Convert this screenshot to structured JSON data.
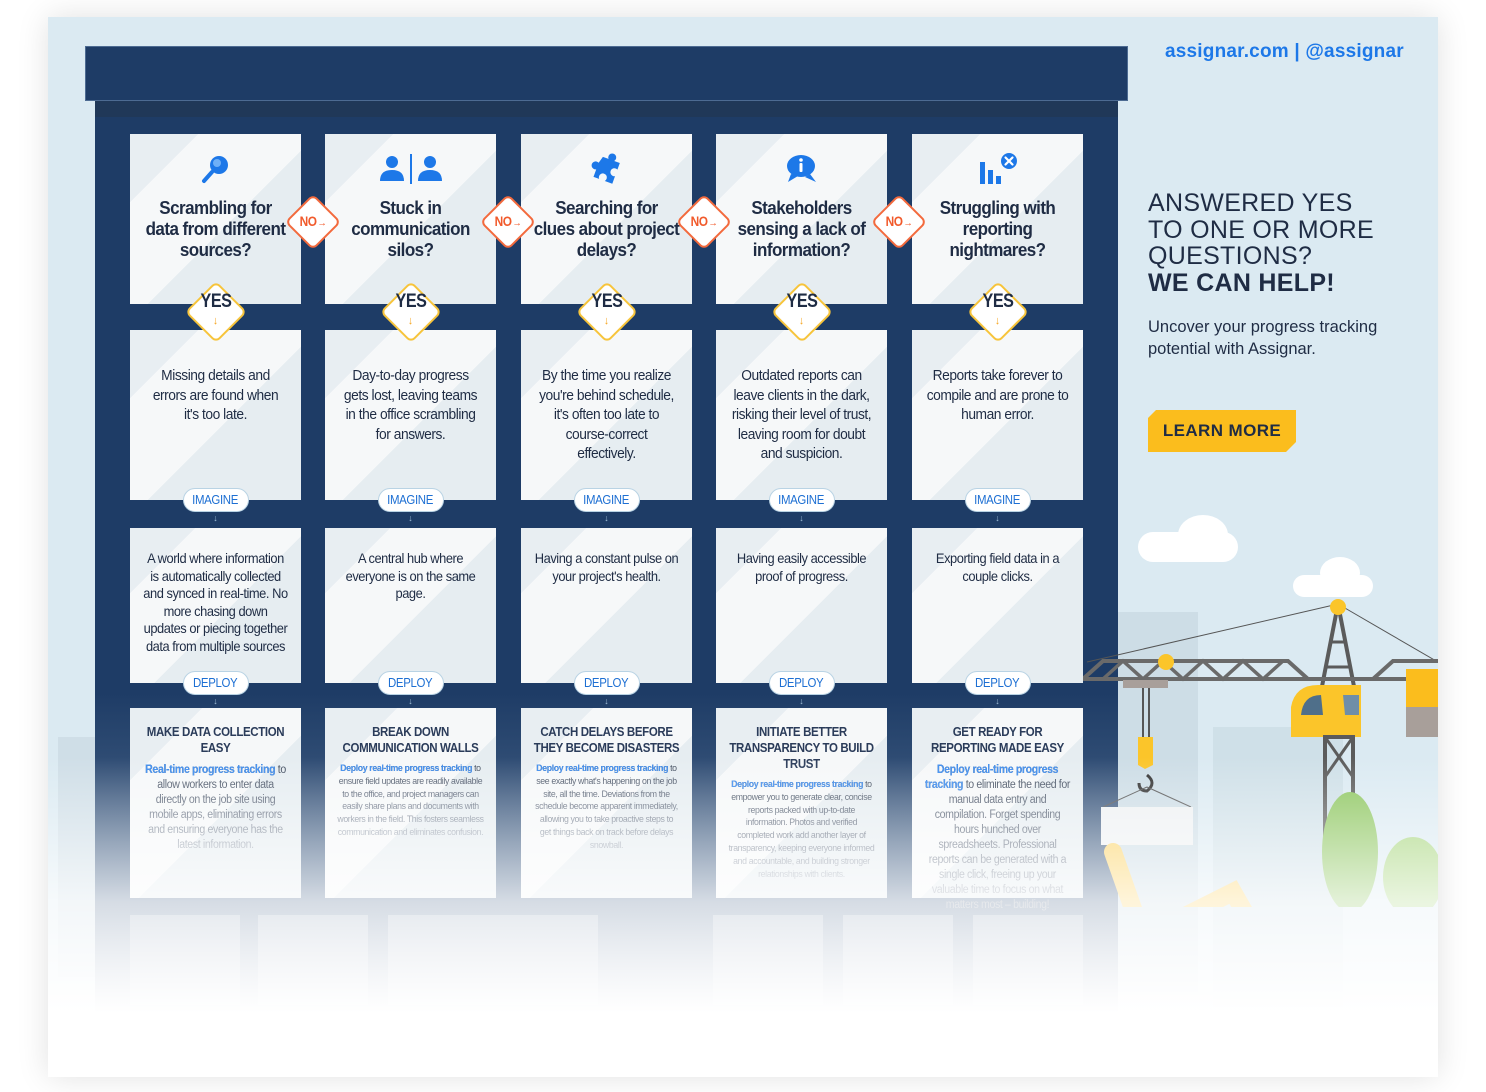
{
  "header": {
    "site_link": "assignar.com | @assignar"
  },
  "cta": {
    "headline_lines": [
      "ANSWERED YES",
      "TO ONE OR MORE",
      "QUESTIONS?"
    ],
    "headline_strong": "WE CAN HELP!",
    "subtext": "Uncover your progress tracking potential with Assignar.",
    "button_label": "LEARN MORE",
    "button_color": "#fbbd1d"
  },
  "labels": {
    "no": "NO",
    "yes": "YES",
    "imagine": "IMAGINE",
    "deploy": "DEPLOY"
  },
  "colors": {
    "building": "#1e3c66",
    "no_badge": "#f15a2b",
    "yes_badge": "#f7c43b",
    "link_blue": "#1d78e8",
    "highlight_blue": "#3f8ef0"
  },
  "columns": [
    {
      "icon": "magnifier-icon",
      "question": "Scrambling for data from different sources?",
      "problem": "Missing details and errors are found when it's too late.",
      "imagine": "A world where information is automatically collected and synced in real-time. No more chasing down updates or piecing together data from multiple sources",
      "solution_title": "MAKE DATA COLLECTION EASY",
      "solution_highlight": "Real-time progress tracking",
      "solution_body": " to allow workers to enter data directly on the job site using mobile apps, eliminating errors and ensuring everyone has the latest information."
    },
    {
      "icon": "users-divided-icon",
      "question": "Stuck in communication silos?",
      "problem": "Day-to-day progress gets lost, leaving teams in the office scrambling for answers.",
      "imagine": "A central hub where everyone is on the same page.",
      "solution_title": "BREAK DOWN COMMUNICATION WALLS",
      "solution_highlight": "Deploy real-time progress tracking",
      "solution_body": " to ensure field updates are readily available to the office, and project managers can easily share plans and documents with workers in the field. This fosters seamless communication and eliminates confusion."
    },
    {
      "icon": "puzzle-piece-icon",
      "question": "Searching for clues about project delays?",
      "problem": "By the time you realize you're behind schedule, it's often too late to course-correct effectively.",
      "imagine": "Having a constant pulse on your project's health.",
      "solution_title": "CATCH DELAYS BEFORE THEY BECOME DISASTERS",
      "solution_highlight": "Deploy real-time progress tracking",
      "solution_body": " to see exactly what's happening on the job site, all the time. Deviations from the schedule become apparent immediately, allowing you to take proactive steps to get things back on track before delays snowball."
    },
    {
      "icon": "info-chat-icon",
      "question": "Stakeholders sensing a lack of information?",
      "problem": "Outdated reports can leave clients in the dark, risking their level of trust, leaving room for doubt and suspicion.",
      "imagine": "Having easily accessible proof of progress.",
      "solution_title": "INITIATE BETTER TRANSPARENCY TO BUILD TRUST",
      "solution_highlight": "Deploy real-time progress tracking",
      "solution_body": " to empower you to generate clear, concise reports packed with up-to-date information. Photos and verified completed work add another layer of transparency, keeping everyone informed and accountable, and building stronger relationships with clients."
    },
    {
      "icon": "bar-chart-error-icon",
      "question": "Struggling with reporting nightmares?",
      "problem": "Reports take forever to compile and are prone to human error.",
      "imagine": "Exporting field data in a couple clicks.",
      "solution_title": "GET READY FOR REPORTING MADE EASY",
      "solution_highlight": "Deploy real-time progress tracking",
      "solution_body": " to eliminate the need for manual data entry and compilation. Forget spending hours hunched over spreadsheets. Professional reports can be generated with a single click, freeing up your valuable time to focus on what matters most – building!"
    }
  ]
}
